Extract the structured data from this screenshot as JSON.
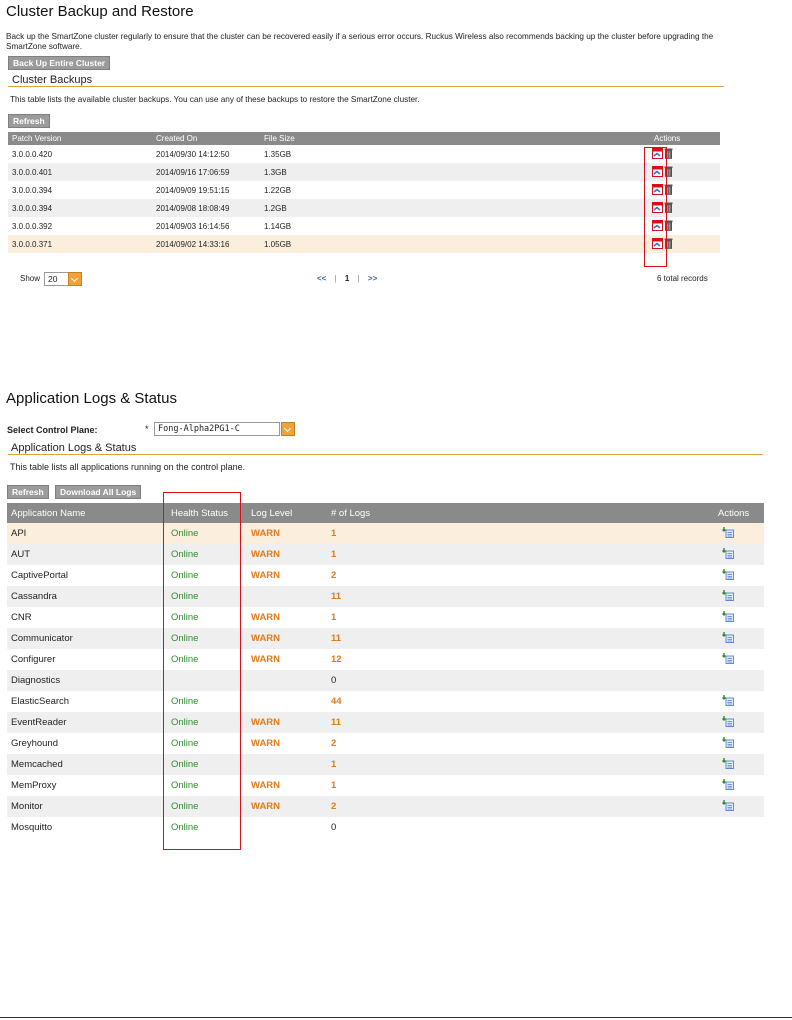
{
  "backup": {
    "title": "Cluster Backup and Restore",
    "description": "Back up the SmartZone cluster regularly to ensure that the cluster can be recovered easily if a serious error occurs. Ruckus Wireless also recommends backing up the cluster before upgrading the SmartZone software.",
    "backup_button": "Back Up Entire Cluster",
    "subheading": "Cluster Backups",
    "table_note": "This table lists the available cluster backups. You can use any of these backups to restore the SmartZone cluster.",
    "refresh_button": "Refresh",
    "columns": [
      "Patch Version",
      "Created On",
      "File Size",
      "Actions"
    ],
    "rows": [
      {
        "version": "3.0.0.0.420",
        "created": "2014/09/30 14:12:50",
        "size": "1.35GB"
      },
      {
        "version": "3.0.0.0.401",
        "created": "2014/09/16 17:06:59",
        "size": "1.3GB"
      },
      {
        "version": "3.0.0.0.394",
        "created": "2014/09/09 19:51:15",
        "size": "1.22GB"
      },
      {
        "version": "3.0.0.0.394",
        "created": "2014/09/08 18:08:49",
        "size": "1.2GB"
      },
      {
        "version": "3.0.0.0.392",
        "created": "2014/09/03 16:14:56",
        "size": "1.14GB"
      },
      {
        "version": "3.0.0.0.371",
        "created": "2014/09/02 14:33:16",
        "size": "1.05GB"
      }
    ],
    "show_label": "Show",
    "show_value": "20",
    "pager_prev": "<<",
    "pager_sep1": "|",
    "pager_page": "1",
    "pager_sep2": "|",
    "pager_next": ">>",
    "total_records": "6 total records"
  },
  "logs": {
    "title": "Application Logs & Status",
    "control_plane_label": "Select Control Plane:",
    "required_mark": "*",
    "control_plane_value": "Fong-Alpha2PG1-C",
    "subheading": "Application Logs & Status",
    "table_note": "This table lists all applications running on the control plane.",
    "refresh_button": "Refresh",
    "download_button": "Download All Logs",
    "columns": [
      "Application Name",
      "Health Status",
      "Log Level",
      "# of Logs",
      "Actions"
    ],
    "rows": [
      {
        "name": "API",
        "status": "Online",
        "level": "WARN",
        "logs": "1",
        "action": true
      },
      {
        "name": "AUT",
        "status": "Online",
        "level": "WARN",
        "logs": "1",
        "action": true
      },
      {
        "name": "CaptivePortal",
        "status": "Online",
        "level": "WARN",
        "logs": "2",
        "action": true
      },
      {
        "name": "Cassandra",
        "status": "Online",
        "level": "",
        "logs": "11",
        "action": true
      },
      {
        "name": "CNR",
        "status": "Online",
        "level": "WARN",
        "logs": "1",
        "action": true
      },
      {
        "name": "Communicator",
        "status": "Online",
        "level": "WARN",
        "logs": "11",
        "action": true
      },
      {
        "name": "Configurer",
        "status": "Online",
        "level": "WARN",
        "logs": "12",
        "action": true
      },
      {
        "name": "Diagnostics",
        "status": "",
        "level": "",
        "logs": "0",
        "action": false
      },
      {
        "name": "ElasticSearch",
        "status": "Online",
        "level": "",
        "logs": "44",
        "action": true
      },
      {
        "name": "EventReader",
        "status": "Online",
        "level": "WARN",
        "logs": "11",
        "action": true
      },
      {
        "name": "Greyhound",
        "status": "Online",
        "level": "WARN",
        "logs": "2",
        "action": true
      },
      {
        "name": "Memcached",
        "status": "Online",
        "level": "",
        "logs": "1",
        "action": true
      },
      {
        "name": "MemProxy",
        "status": "Online",
        "level": "WARN",
        "logs": "1",
        "action": true
      },
      {
        "name": "Monitor",
        "status": "Online",
        "level": "WARN",
        "logs": "2",
        "action": true
      },
      {
        "name": "Mosquitto",
        "status": "Online",
        "level": "",
        "logs": "0",
        "action": false
      }
    ]
  },
  "colors": {
    "header_gray": "#8a8a8a",
    "online_green": "#2e8b2e",
    "warn_orange": "#e07b1a",
    "highlight_red": "#d6101a",
    "underline_gold": "#d9a441"
  }
}
